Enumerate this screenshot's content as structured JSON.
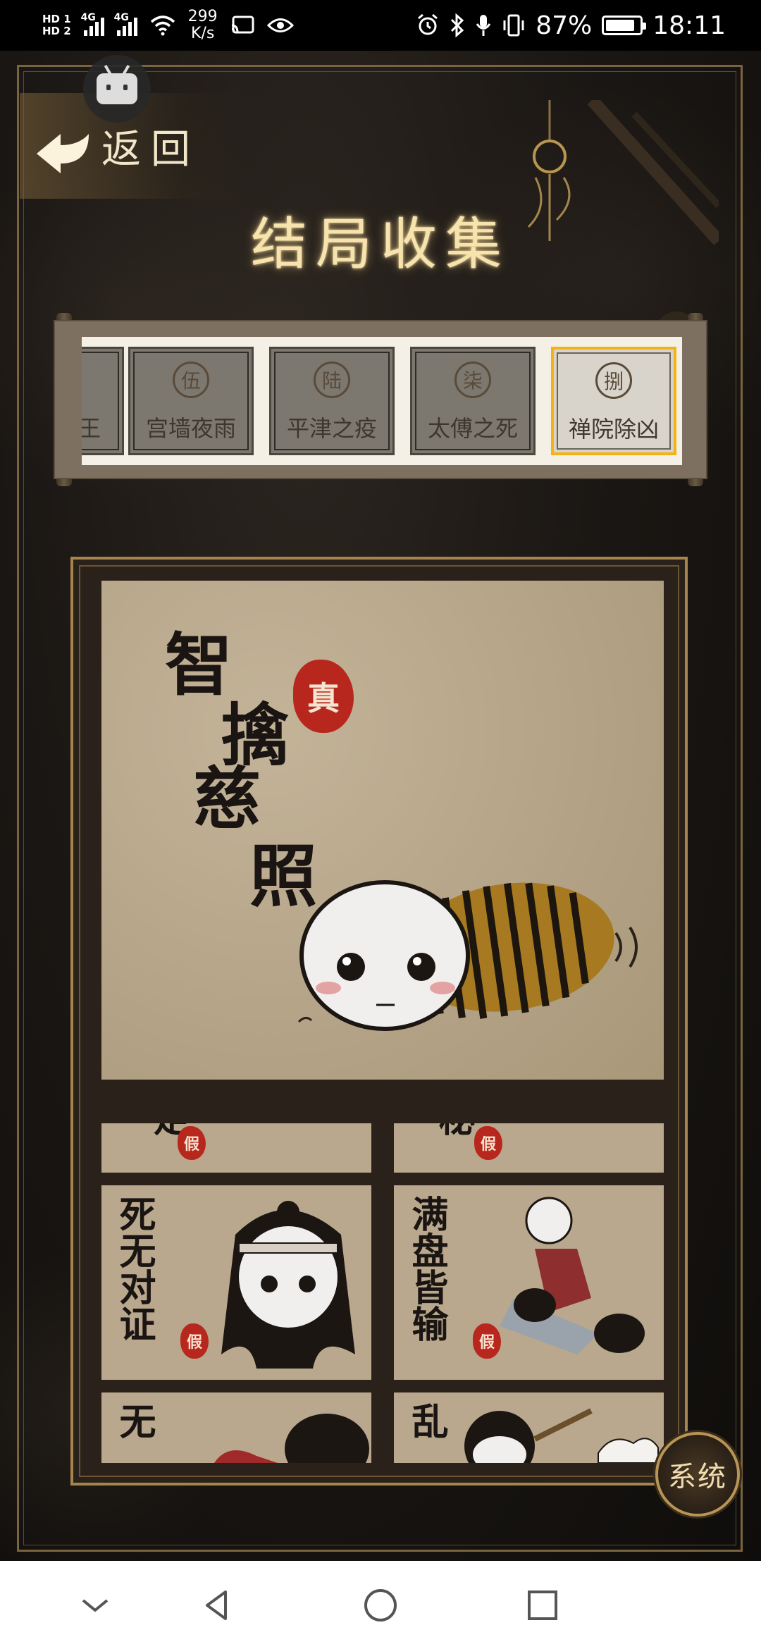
{
  "status_bar": {
    "hd1": "HD 1",
    "hd2": "HD 2",
    "net1": "4G",
    "net2": "4G",
    "speed_value": "299",
    "speed_unit": "K/s",
    "battery_text": "87%",
    "battery_level": 0.87,
    "time": "18:11"
  },
  "header": {
    "back_label": "返回",
    "title": "结局收集"
  },
  "endings_tabs": [
    {
      "num": "",
      "label": "王",
      "selected": false
    },
    {
      "num": "伍",
      "label": "宫墙夜雨",
      "selected": false
    },
    {
      "num": "陆",
      "label": "平津之疫",
      "selected": false
    },
    {
      "num": "柒",
      "label": "太傅之死",
      "selected": false
    },
    {
      "num": "捌",
      "label": "禅院除凶",
      "selected": true
    }
  ],
  "featured_ending": {
    "title_chars": "智擒慈照",
    "seal": "真"
  },
  "thumbnails": [
    {
      "text": "足",
      "seal": "假"
    },
    {
      "text": "秘",
      "seal": "假"
    },
    {
      "text": "死无对证",
      "seal": "假"
    },
    {
      "text": "满盘皆输",
      "seal": "假"
    },
    {
      "text": "无",
      "seal": ""
    },
    {
      "text": "乱",
      "seal": ""
    }
  ],
  "system_button": {
    "label": "系统"
  },
  "colors": {
    "accent_gold": "#f5b214",
    "seal_red": "#b8271d",
    "paper": "#b9a88d"
  }
}
